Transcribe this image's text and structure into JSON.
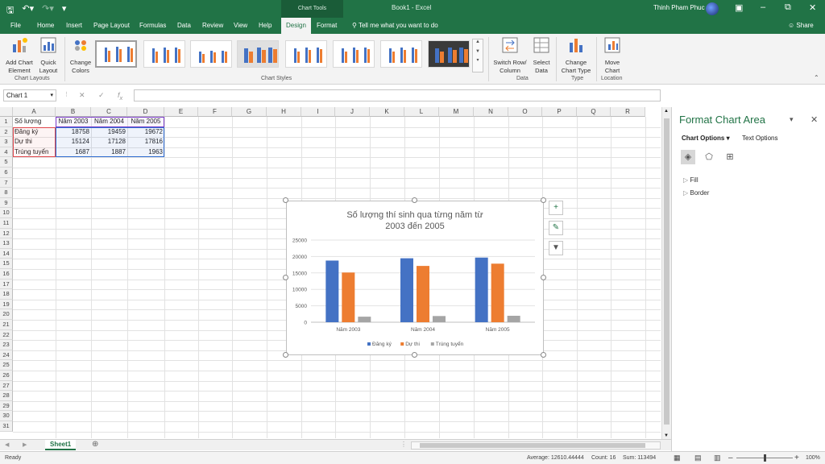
{
  "titlebar": {
    "context_tab": "Chart Tools",
    "title": "Book1  -  Excel",
    "user": "Thinh Pham Phuc"
  },
  "tabs": [
    "File",
    "Home",
    "Insert",
    "Page Layout",
    "Formulas",
    "Data",
    "Review",
    "View",
    "Help",
    "Design",
    "Format"
  ],
  "active_tab": "Design",
  "tell_me": "Tell me what you want to do",
  "share": "Share",
  "ribbon": {
    "add_chart_element": "Add Chart Element",
    "quick_layout": "Quick Layout",
    "change_colors": "Change Colors",
    "switch_row_column": "Switch Row/ Column",
    "select_data": "Select Data",
    "change_chart_type": "Change Chart Type",
    "move_chart": "Move Chart",
    "groups": {
      "chart_layouts": "Chart Layouts",
      "chart_styles": "Chart Styles",
      "data": "Data",
      "type": "Type",
      "location": "Location"
    }
  },
  "name_box": "Chart 1",
  "columns": [
    "A",
    "B",
    "C",
    "D",
    "E",
    "F",
    "G",
    "H",
    "I",
    "J",
    "K",
    "L",
    "M",
    "N",
    "O",
    "P",
    "Q",
    "R"
  ],
  "rows": [
    "1",
    "2",
    "3",
    "4",
    "5",
    "6",
    "7",
    "8",
    "9",
    "10",
    "11",
    "12",
    "13",
    "14",
    "15",
    "16",
    "17",
    "18",
    "19",
    "20",
    "21",
    "22",
    "23",
    "24",
    "25",
    "26",
    "27",
    "28",
    "29",
    "30",
    "31"
  ],
  "table": {
    "header": [
      "Số lượng",
      "Năm 2003",
      "Năm 2004",
      "Năm 2005"
    ],
    "rows": [
      [
        "Đăng ký",
        "18758",
        "19459",
        "19672"
      ],
      [
        "Dự thi",
        "15124",
        "17128",
        "17816"
      ],
      [
        "Trúng tuyển",
        "1687",
        "1887",
        "1963"
      ]
    ]
  },
  "chart_data": {
    "type": "bar",
    "title": "Số lượng thí sinh qua từng năm từ 2003 đến 2005",
    "categories": [
      "Năm 2003",
      "Năm 2004",
      "Năm 2005"
    ],
    "series": [
      {
        "name": "Đăng ký",
        "values": [
          18758,
          19459,
          19672
        ],
        "color": "#4472c4"
      },
      {
        "name": "Dự thi",
        "values": [
          15124,
          17128,
          17816
        ],
        "color": "#ed7d31"
      },
      {
        "name": "Trúng tuyển",
        "values": [
          1687,
          1887,
          1963
        ],
        "color": "#a5a5a5"
      }
    ],
    "ylim": [
      0,
      25000
    ],
    "yticks": [
      "0",
      "5000",
      "10000",
      "15000",
      "20000",
      "25000"
    ],
    "legend": "bottom",
    "grid": true
  },
  "sheet_tab": "Sheet1",
  "status": {
    "ready": "Ready",
    "average": "Average: 12610.44444",
    "count": "Count: 16",
    "sum": "Sum: 113494",
    "zoom": "100%"
  },
  "pane": {
    "title": "Format Chart Area",
    "chart_options": "Chart Options",
    "text_options": "Text Options",
    "fill": "Fill",
    "border": "Border"
  },
  "colors": {
    "excel_green": "#217346"
  }
}
